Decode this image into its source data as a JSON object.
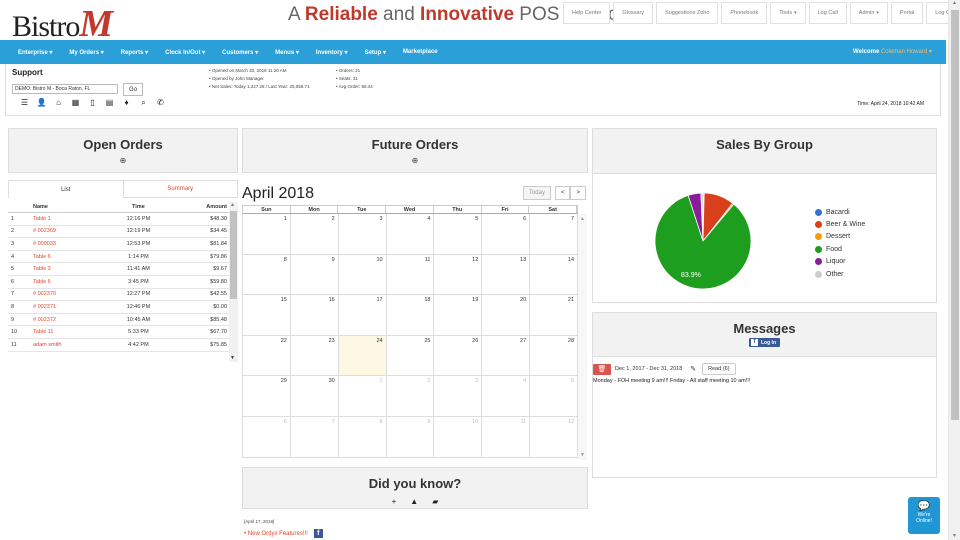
{
  "header": {
    "logo_text": "Bistro",
    "logo_m": "M",
    "tagline_a": "A ",
    "tagline_reliable": "Reliable",
    "tagline_and": " and ",
    "tagline_innovative": "Innovative",
    "tagline_rest": " POS Service",
    "links": [
      "Help Center",
      "Glossary",
      "Suggestions Zoho",
      "Phonebook",
      "Tools",
      "Log Call",
      "Admin",
      "Portal",
      "Log Out"
    ]
  },
  "nav": {
    "items": [
      "Enterprise",
      "My Orders",
      "Reports",
      "Clock In/Out",
      "Customers",
      "Menus",
      "Inventory",
      "Setup",
      "Marketplace"
    ],
    "welcome": "Welcome ",
    "user": "Coleman Howard"
  },
  "support": {
    "title": "Support",
    "location": "DEMO: Bistro M - Boca Raton, FL",
    "go": "Go",
    "stats_left": [
      "• Opened on March 30, 2018 11:20 AM",
      "• Opened by John Manager",
      "• Net Sales: Today 1,227.28 / Last Year: 25,058.71"
    ],
    "stats_right": [
      "• Orders: 21",
      "• Seats: 31",
      "• Avg Order: 58.44"
    ],
    "time": "Time: April 24, 2018 10:42 AM"
  },
  "open_orders": {
    "title": "Open Orders",
    "tab_list": "List",
    "tab_summary": "Summary",
    "columns": [
      "Name",
      "Time",
      "Amount"
    ],
    "rows": [
      {
        "n": "1",
        "name": "Table 1",
        "time": "12:16 PM",
        "amount": "$48.30"
      },
      {
        "n": "2",
        "name": "# 002369",
        "time": "12:19 PM",
        "amount": "$34.45"
      },
      {
        "n": "3",
        "name": "# 009033",
        "time": "12:53 PM",
        "amount": "$81.84"
      },
      {
        "n": "4",
        "name": "Table 6",
        "time": "1:14 PM",
        "amount": "$79.86"
      },
      {
        "n": "5",
        "name": "Table 3",
        "time": "11:41 AM",
        "amount": "$9.67"
      },
      {
        "n": "6",
        "name": "Table 6",
        "time": "3:45 PM",
        "amount": "$59.80"
      },
      {
        "n": "7",
        "name": "# 002370",
        "time": "12:27 PM",
        "amount": "$42.55"
      },
      {
        "n": "8",
        "name": "# 002371",
        "time": "12:46 PM",
        "amount": "$0.00"
      },
      {
        "n": "9",
        "name": "# 002372",
        "time": "10:45 AM",
        "amount": "$85.48"
      },
      {
        "n": "10",
        "name": "Table 11",
        "time": "5:33 PM",
        "amount": "$67.70"
      },
      {
        "n": "11",
        "name": "adam smith",
        "time": "4:42 PM",
        "amount": "$75.85"
      }
    ]
  },
  "future_orders": {
    "title": "Future Orders",
    "month": "April 2018",
    "today_btn": "Today",
    "dow": [
      "Sun",
      "Mon",
      "Tue",
      "Wed",
      "Thu",
      "Fri",
      "Sat"
    ],
    "weeks": [
      [
        {
          "d": "1"
        },
        {
          "d": "2"
        },
        {
          "d": "3"
        },
        {
          "d": "4"
        },
        {
          "d": "5"
        },
        {
          "d": "6"
        },
        {
          "d": "7"
        }
      ],
      [
        {
          "d": "8"
        },
        {
          "d": "9"
        },
        {
          "d": "10"
        },
        {
          "d": "11"
        },
        {
          "d": "12"
        },
        {
          "d": "13"
        },
        {
          "d": "14"
        }
      ],
      [
        {
          "d": "15"
        },
        {
          "d": "16"
        },
        {
          "d": "17"
        },
        {
          "d": "18"
        },
        {
          "d": "19"
        },
        {
          "d": "20"
        },
        {
          "d": "21"
        }
      ],
      [
        {
          "d": "22"
        },
        {
          "d": "23"
        },
        {
          "d": "24",
          "today": true
        },
        {
          "d": "25"
        },
        {
          "d": "26"
        },
        {
          "d": "27"
        },
        {
          "d": "28"
        }
      ],
      [
        {
          "d": "29"
        },
        {
          "d": "30"
        },
        {
          "d": "1",
          "other": true
        },
        {
          "d": "2",
          "other": true
        },
        {
          "d": "3",
          "other": true
        },
        {
          "d": "4",
          "other": true
        },
        {
          "d": "5",
          "other": true
        }
      ],
      [
        {
          "d": "6",
          "other": true
        },
        {
          "d": "7",
          "other": true
        },
        {
          "d": "8",
          "other": true
        },
        {
          "d": "9",
          "other": true
        },
        {
          "d": "10",
          "other": true
        },
        {
          "d": "11",
          "other": true
        },
        {
          "d": "12",
          "other": true
        }
      ]
    ]
  },
  "did_you_know": {
    "title": "Did you know?",
    "date": "[April 17, 2018]",
    "link": "New Ordyx Features!!!"
  },
  "sales_by_group": {
    "title": "Sales By Group",
    "slice_label": "83.9%"
  },
  "chart_data": {
    "type": "pie",
    "labels": [
      "Bacardi",
      "Beer & Wine",
      "Dessert",
      "Food",
      "Liquor",
      "Other"
    ],
    "values": [
      0.4,
      10.2,
      0.5,
      83.9,
      4.3,
      0.7
    ],
    "colors": [
      "#3b6fd0",
      "#d7401b",
      "#f39c12",
      "#1e9e1e",
      "#8a1c9b",
      "#cccccc"
    ],
    "legend": "right"
  },
  "messages": {
    "title": "Messages",
    "login": "Log In",
    "date_range": "Dec 1, 2017 - Dec 31, 2018",
    "read_btn": "Read (6)",
    "text": "Monday - FOH meeting 9 am!!! Friday - All staff meeting 10 am!!!"
  },
  "chat": {
    "line1": "We're",
    "line2": "Online!"
  }
}
